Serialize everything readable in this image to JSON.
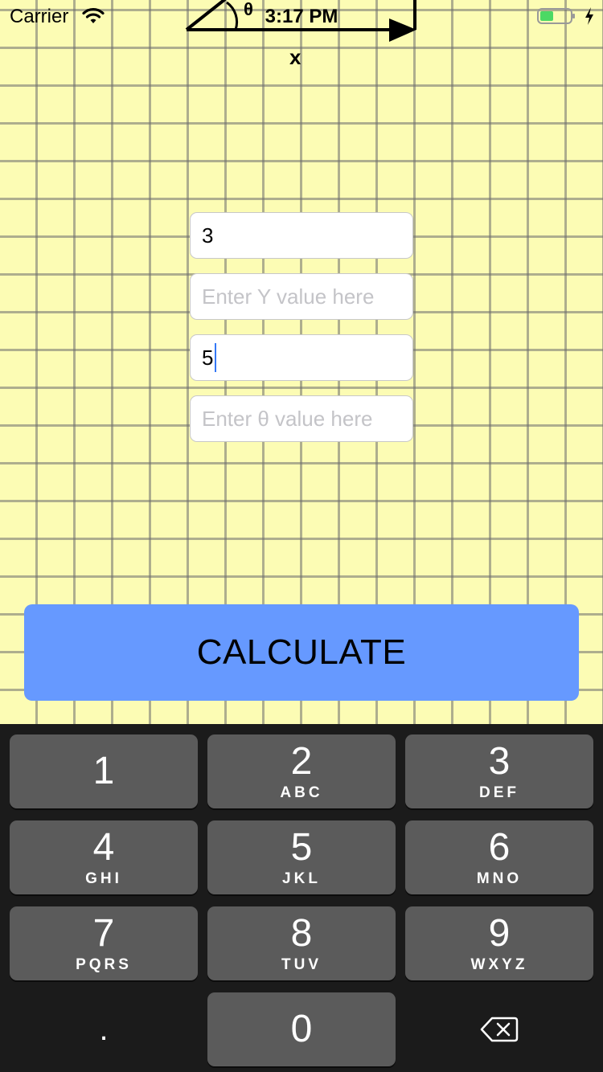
{
  "status_bar": {
    "carrier": "Carrier",
    "time": "3:17 PM",
    "wifi_icon": "wifi-icon",
    "battery_icon": "battery-icon",
    "charging_icon": "bolt-icon"
  },
  "diagram": {
    "angle_label": "θ",
    "x_label": "x"
  },
  "inputs": {
    "x": {
      "value": "3",
      "placeholder": ""
    },
    "y": {
      "value": "",
      "placeholder": "Enter Y value here"
    },
    "r": {
      "value": "5",
      "placeholder": ""
    },
    "theta": {
      "value": "",
      "placeholder": "Enter θ value here"
    }
  },
  "calculate_button": {
    "label": "CALCULATE",
    "color": "#6699ff"
  },
  "keyboard": {
    "keys": [
      {
        "num": "1",
        "letters": ""
      },
      {
        "num": "2",
        "letters": "ABC"
      },
      {
        "num": "3",
        "letters": "DEF"
      },
      {
        "num": "4",
        "letters": "GHI"
      },
      {
        "num": "5",
        "letters": "JKL"
      },
      {
        "num": "6",
        "letters": "MNO"
      },
      {
        "num": "7",
        "letters": "PQRS"
      },
      {
        "num": "8",
        "letters": "TUV"
      },
      {
        "num": "9",
        "letters": "WXYZ"
      },
      {
        "num": "0",
        "letters": ""
      }
    ],
    "decimal": ".",
    "delete_icon": "delete-backspace-icon"
  },
  "colors": {
    "paper": "#fcfcb4",
    "keyboard_bg": "#1b1b1b",
    "key_bg": "#5b5b5b",
    "battery_fill": "#4cd964"
  }
}
